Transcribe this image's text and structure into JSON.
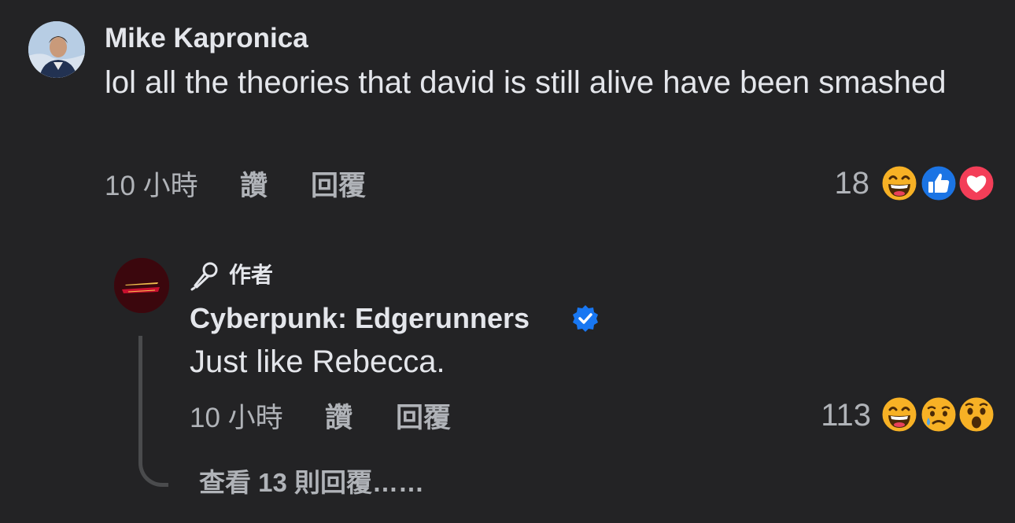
{
  "comment": {
    "author": "Mike Kapronica",
    "text": "lol all the theories that david is still alive have been smashed",
    "time": "10 小時",
    "like_label": "讚",
    "reply_label": "回覆",
    "reaction_count": "18",
    "reactions": [
      "haha-icon",
      "like-icon",
      "love-icon"
    ]
  },
  "reply": {
    "author_badge": "作者",
    "author": "Cyberpunk: Edgerunners",
    "verified": true,
    "text": "Just like Rebecca.",
    "time": "10 小時",
    "like_label": "讚",
    "reply_label": "回覆",
    "reaction_count": "113",
    "reactions": [
      "haha-icon",
      "sad-icon",
      "wow-icon"
    ]
  },
  "view_more_replies": "查看 13 則回覆……",
  "colors": {
    "background": "#232325",
    "primary_text": "#e4e6eb",
    "secondary_text": "#b0b3b8",
    "verified_blue": "#1877f2",
    "like_blue": "#1b74e4",
    "love_red": "#f33e58",
    "emoji_yellow": "#f7b125"
  }
}
